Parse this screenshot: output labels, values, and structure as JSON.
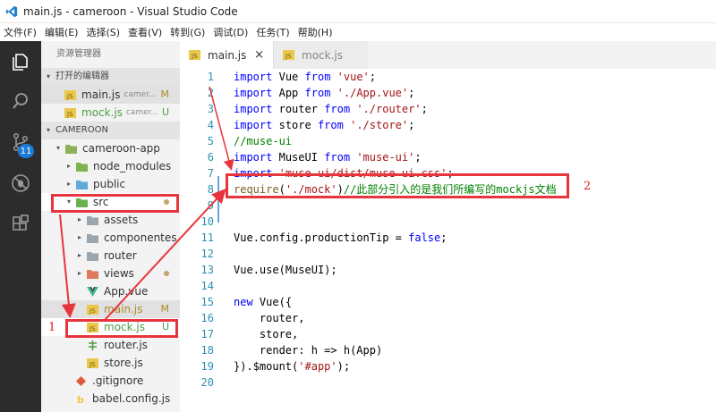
{
  "window": {
    "title": "main.js - cameroon - Visual Studio Code"
  },
  "menu": [
    "文件(F)",
    "编辑(E)",
    "选择(S)",
    "查看(V)",
    "转到(G)",
    "调试(D)",
    "任务(T)",
    "帮助(H)"
  ],
  "activity": {
    "badge": "11"
  },
  "sidebar": {
    "title": "资源管理器",
    "open_editors_label": "打开的编辑器",
    "open_editors": [
      {
        "name": "main.js",
        "path": "camer...",
        "status": "M"
      },
      {
        "name": "mock.js",
        "path": "camer...",
        "status": "U"
      }
    ],
    "project_label": "CAMEROON",
    "tree": {
      "root": "cameroon-app",
      "node_modules": "node_modules",
      "public": "public",
      "src": "src",
      "assets": "assets",
      "componentes": "componentes",
      "router": "router",
      "views": "views",
      "app_vue": "App.vue",
      "main_js": "main.js",
      "main_js_status": "M",
      "mock_js": "mock.js",
      "mock_js_status": "U",
      "router_js": "router.js",
      "store_js": "store.js",
      "gitignore": ".gitignore",
      "babel": "babel.config.js"
    }
  },
  "tabs": [
    {
      "label": "main.js",
      "active": true,
      "close": "×"
    },
    {
      "label": "mock.js",
      "active": false
    }
  ],
  "editor": {
    "line_numbers": [
      "1",
      "2",
      "3",
      "4",
      "5",
      "6",
      "7",
      "8",
      "9",
      "10",
      "11",
      "12",
      "13",
      "14",
      "15",
      "16",
      "17",
      "18",
      "19",
      "20"
    ],
    "lines": {
      "l1": {
        "kw": "import",
        "id": "Vue",
        "from": "from",
        "str": "'vue'",
        "end": ";"
      },
      "l2": {
        "kw": "import",
        "id": "App",
        "from": "from",
        "str": "'./App.vue'",
        "end": ";"
      },
      "l3": {
        "kw": "import",
        "id": "router",
        "from": "from",
        "str": "'./router'",
        "end": ";"
      },
      "l4": {
        "kw": "import",
        "id": "store",
        "from": "from",
        "str": "'./store'",
        "end": ";"
      },
      "l5": {
        "cm": "//muse-ui"
      },
      "l6": {
        "kw": "import",
        "id": "MuseUI",
        "from": "from",
        "str": "'muse-ui'",
        "end": ";"
      },
      "l7": {
        "kw": "import",
        "str": "'muse-ui/dist/muse-ui.css'",
        "end": ";"
      },
      "l8": {
        "fn": "require",
        "open": "(",
        "str": "'./mock'",
        "close": ")",
        "cm": "//此部分引入的是我们所编写的mockjs文档"
      },
      "l11": {
        "id1": "Vue",
        "dot1": ".",
        "id2": "config",
        "dot2": ".",
        "id3": "productionTip",
        "eq": " = ",
        "kw": "false",
        "end": ";"
      },
      "l13": {
        "id": "Vue",
        "dot": ".",
        "fn": "use",
        "arg": "(MuseUI);"
      },
      "l15": {
        "kw": "new",
        "fn": "Vue",
        "rest": "({"
      },
      "l16": {
        "id": "router",
        "end": ","
      },
      "l17": {
        "id": "store",
        "end": ","
      },
      "l18": {
        "id": "render",
        "mid": ": h => ",
        "fn": "h",
        "rest": "(App)"
      },
      "l19": {
        "pre": "}).",
        "fn": "$mount",
        "open": "(",
        "str": "'#app'",
        "close": ");"
      }
    }
  },
  "annotations": {
    "label1": "1",
    "label2": "2"
  },
  "colors": {
    "accent_red": "#e8343c",
    "keyword": "#0000ff",
    "string": "#a31515",
    "comment": "#008000",
    "line_number": "#2b91af"
  }
}
